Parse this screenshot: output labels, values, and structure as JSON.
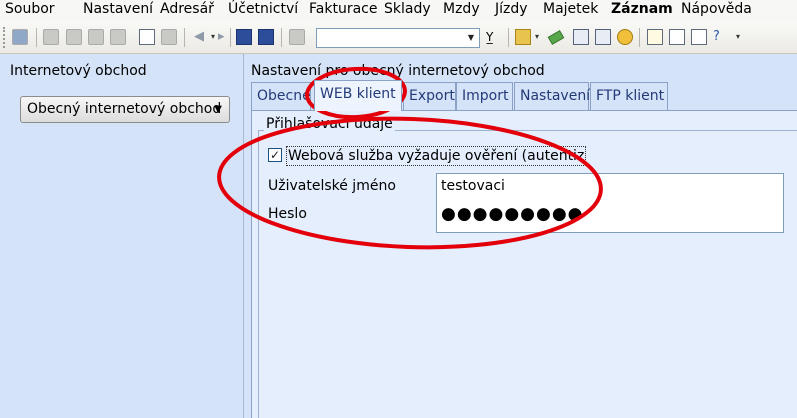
{
  "menu": [
    "Soubor",
    "Nastavení",
    "Adresář",
    "Účetnictví",
    "Fakturace",
    "Sklady",
    "Mzdy",
    "Jízdy",
    "Majetek",
    "Záznam",
    "Nápověda"
  ],
  "menu_bold": "Záznam",
  "toolbar": {
    "combo_value": "",
    "icons": [
      "toggle-icon",
      "copy-icon",
      "copy-multi-icon",
      "preview-icon",
      "print-icon",
      "new-document-icon",
      "broom-icon",
      "back-arrow-icon",
      "forward-arrow-icon",
      "save-icon",
      "save-all-icon",
      "clipboard-icon",
      "filter-icon",
      "folder-icon",
      "money-icon",
      "calculator-icon",
      "coins-icon",
      "note-icon",
      "list-icon",
      "card-icon",
      "help-icon"
    ]
  },
  "left_panel": {
    "title": "Internetový obchod",
    "selected_shop": "Obecný internetový obchod"
  },
  "settings": {
    "title": "Nastavení pro obecný internetový obchod",
    "tabs": [
      "Obecné",
      "WEB klient",
      "Export",
      "Import",
      "Nastavení",
      "FTP klient"
    ],
    "active_tab": "WEB klient"
  },
  "login": {
    "group_caption": "Přihlašovací údaje",
    "auth_checkbox_label": "Webová služba vyžaduje ověření (autentiz",
    "auth_checked": true,
    "username_label": "Uživatelské jméno",
    "username_value": "testovaci",
    "password_label": "Heslo",
    "password_value": "●●●●●●●●●"
  },
  "colors": {
    "background": "#d4e3f7",
    "annotation": "#e3000b",
    "tab_text": "#233a78"
  }
}
